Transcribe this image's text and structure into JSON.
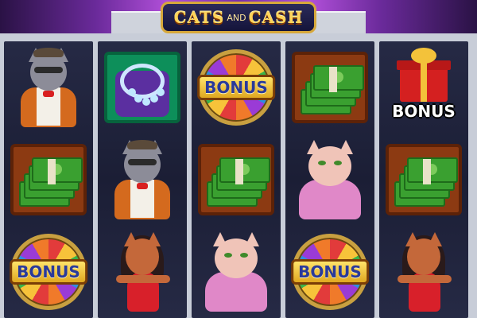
{
  "game": {
    "title_left": "CATS",
    "title_mid": "AND",
    "title_right": "CASH"
  },
  "reels": [
    [
      "cat-gangster",
      "cash",
      "bonus-wheel"
    ],
    [
      "jewel-necklace",
      "cat-gangster",
      "cat-diva"
    ],
    [
      "bonus-wheel",
      "cash",
      "cat-persian"
    ],
    [
      "cash",
      "cat-persian",
      "bonus-wheel"
    ],
    [
      "bonus-gift",
      "cash",
      "cat-diva"
    ]
  ],
  "symbols": {
    "bonus_text": "BONUS"
  },
  "colors": {
    "reel_bg": "#1b1e35",
    "frame": "#c8cdd8",
    "cash_frame": "#8c3a12",
    "jewel_frame": "#0d8f5a",
    "bonus_plate": "#ffd34a"
  }
}
